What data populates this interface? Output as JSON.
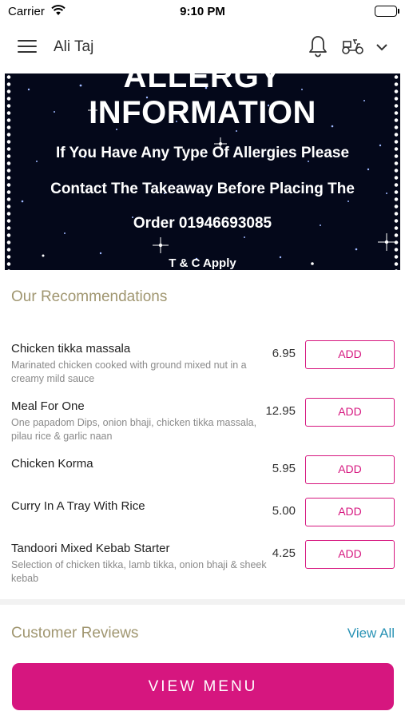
{
  "status_bar": {
    "carrier": "Carrier",
    "time": "9:10 PM"
  },
  "header": {
    "title": "Ali Taj",
    "menu_icon": "hamburger-icon",
    "notification_icon": "bell-icon",
    "delivery_icon": "scooter-icon",
    "dropdown_icon": "chevron-down-icon"
  },
  "banner": {
    "heading_line1": "ALLERGY",
    "heading_line2": "INFORMATION",
    "line1": "If You Have Any Type Of Allergies Please",
    "line2": "Contact The Takeaway Before Placing The",
    "line3": "Order 01946693085",
    "terms": "T & C Apply"
  },
  "recommendations": {
    "title": "Our Recommendations",
    "add_label": "ADD",
    "items": [
      {
        "name": "Chicken tikka massala",
        "description": "Marinated chicken cooked with ground mixed nut in a creamy mild sauce",
        "price": "6.95"
      },
      {
        "name": "Meal For One",
        "description": "One papadom Dips, onion bhaji, chicken tikka massala, pilau rice & garlic naan",
        "price": "12.95"
      },
      {
        "name": "Chicken Korma",
        "description": "",
        "price": "5.95"
      },
      {
        "name": "Curry In A Tray With Rice",
        "description": "",
        "price": "5.00"
      },
      {
        "name": "Tandoori Mixed Kebab Starter",
        "description": "Selection of chicken tikka, lamb tikka, onion bhaji & sheek kebab",
        "price": "4.25"
      }
    ]
  },
  "reviews": {
    "title": "Customer Reviews",
    "view_all": "View All"
  },
  "footer": {
    "view_menu": "VIEW MENU"
  },
  "colors": {
    "accent": "#d6167f",
    "section_title": "#a09670",
    "link": "#2a93b5",
    "banner_bg": "#04081a"
  }
}
